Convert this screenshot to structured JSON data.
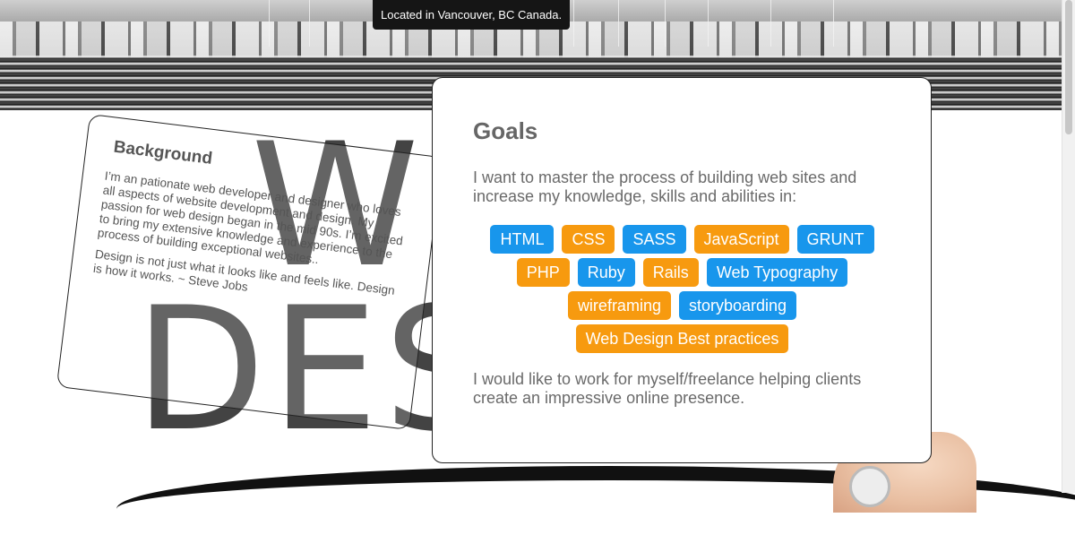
{
  "hero": {
    "tooltip": "Located in Vancouver, BC Canada."
  },
  "artwork": {
    "line1": "W",
    "line2": "DES"
  },
  "background_card": {
    "title": "Background",
    "paragraph1": "I’m an pationate web developer and designer who loves all aspects of website development and design. My passion for web design began in the mid 90s. I’m excited to bring my extensive knowledge and experience to the process of building exceptional websites..",
    "paragraph2": "Design is not just what it looks like and feels like. Design is how it works. ~ Steve Jobs"
  },
  "goals_card": {
    "title": "Goals",
    "intro": "I want to master the process of building web sites and increase my knowledge, skills and abilities in:",
    "outro": "I would like to work for myself/freelance helping clients create an impressive online presence.",
    "skills": [
      {
        "label": "HTML",
        "color": "blue"
      },
      {
        "label": "CSS",
        "color": "orange"
      },
      {
        "label": "SASS",
        "color": "blue"
      },
      {
        "label": "JavaScript",
        "color": "orange"
      },
      {
        "label": "GRUNT",
        "color": "blue"
      },
      {
        "label": "PHP",
        "color": "orange"
      },
      {
        "label": "Ruby",
        "color": "blue"
      },
      {
        "label": "Rails",
        "color": "orange"
      },
      {
        "label": "Web Typography",
        "color": "blue"
      },
      {
        "label": "wireframing",
        "color": "orange"
      },
      {
        "label": "storyboarding",
        "color": "blue"
      },
      {
        "label": "Web Design Best practices",
        "color": "orange"
      }
    ]
  },
  "colors": {
    "tag_blue": "#1896ec",
    "tag_orange": "#f79a0f"
  }
}
